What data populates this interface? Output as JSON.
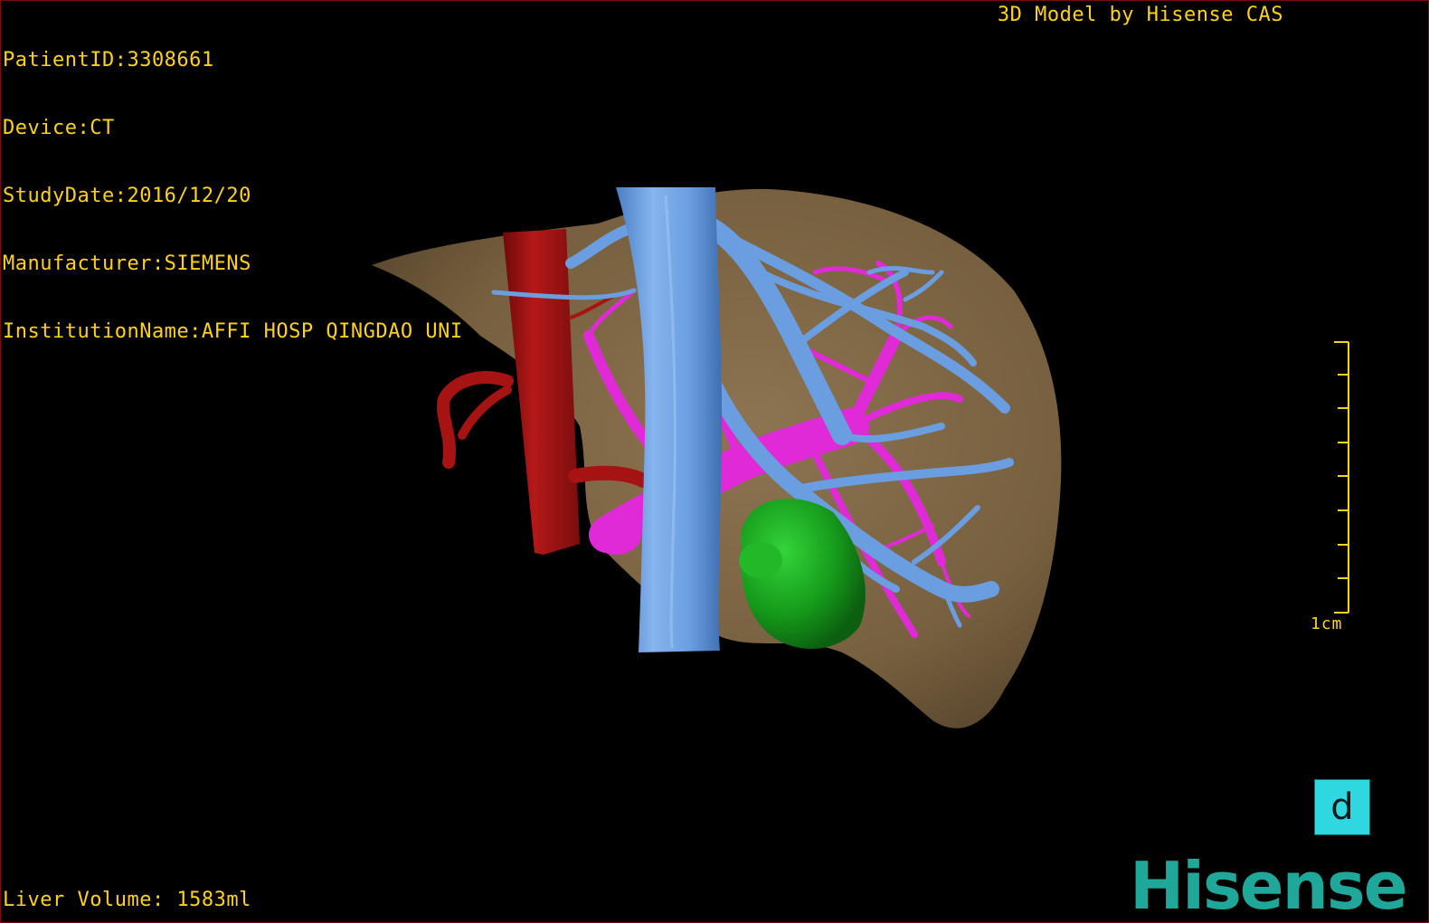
{
  "patient_info": {
    "patient_id": "PatientID:3308661",
    "device": "Device:CT",
    "study_date": "StudyDate:2016/12/20",
    "manufacturer": "Manufacturer:SIEMENS",
    "institution": "InstitutionName:AFFI HOSP QINGDAO UNI"
  },
  "header_right": "3D Model by Hisense CAS",
  "footer": {
    "liver_volume": "Liver Volume: 1583ml"
  },
  "scale_bar": {
    "label": "1cm"
  },
  "orientation_marker": {
    "letter": "d"
  },
  "brand": {
    "logo_text": "Hisense"
  },
  "colors": {
    "overlay_text": "#ffd21a",
    "liver": "#7d6547",
    "artery": "#9b1010",
    "portal_vein": "#e02ad8",
    "hepatic_vein": "#6a9ee0",
    "gallbladder": "#17a81c",
    "logo": "#1fa89a",
    "orientation_box": "#2fd8e0"
  }
}
